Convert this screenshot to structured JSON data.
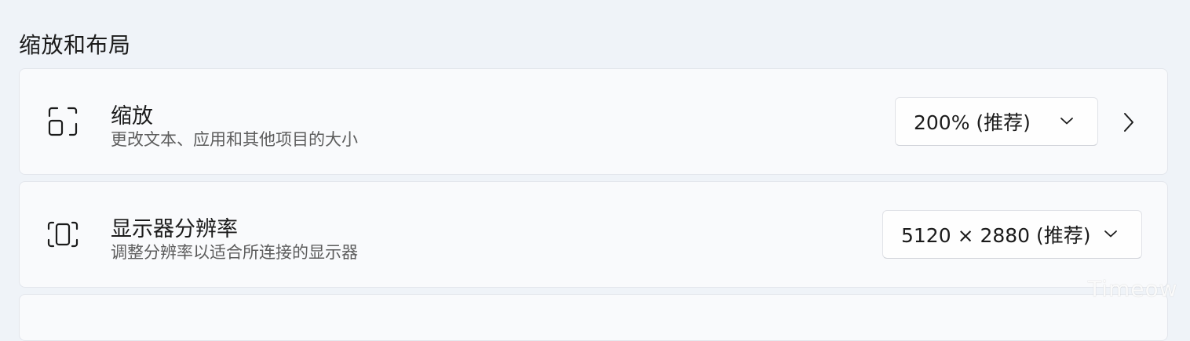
{
  "section": {
    "title": "缩放和布局"
  },
  "scale": {
    "title": "缩放",
    "subtitle": "更改文本、应用和其他项目的大小",
    "selected": "200% (推荐)",
    "icon": "scale-icon"
  },
  "resolution": {
    "title": "显示器分辨率",
    "subtitle": "调整分辨率以适合所连接的显示器",
    "selected": "5120 × 2880 (推荐)",
    "icon": "resolution-icon"
  },
  "watermark": "Timeow"
}
